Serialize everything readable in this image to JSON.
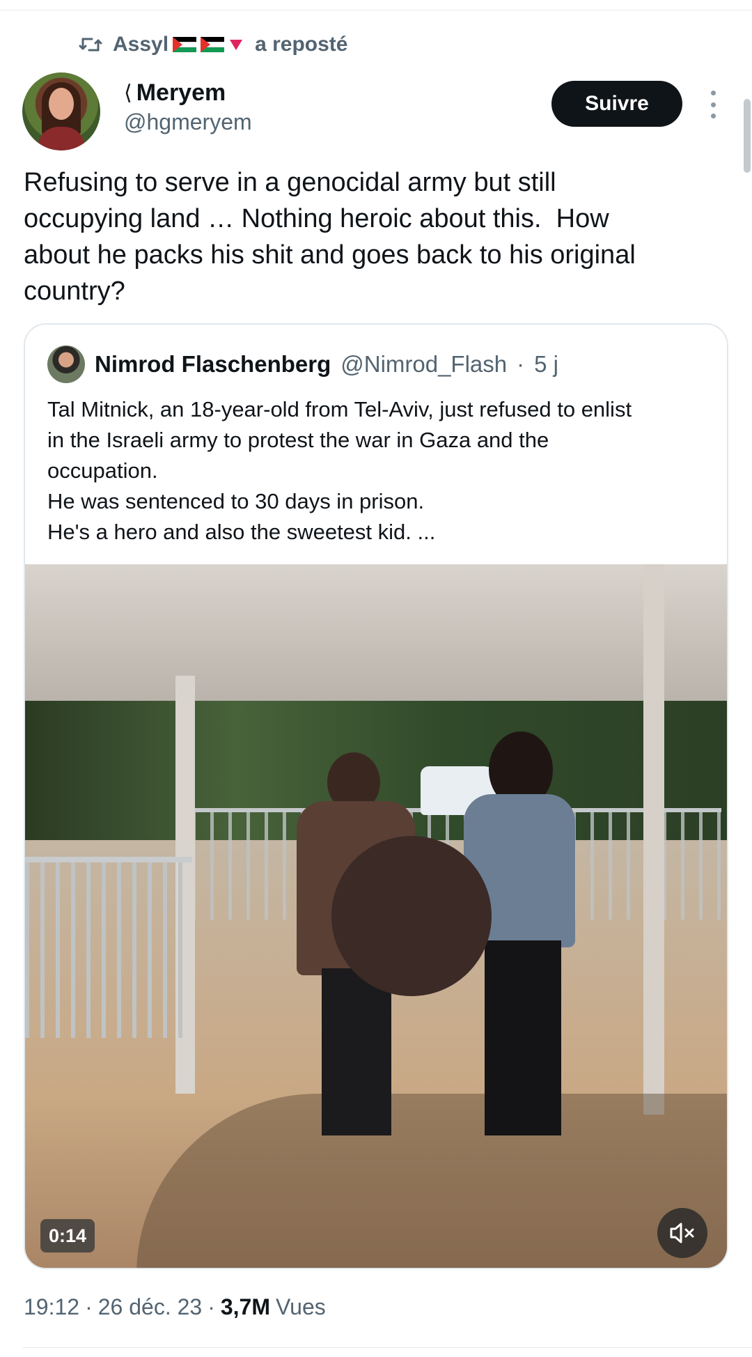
{
  "repost": {
    "icon": "retweet-icon",
    "user_name": "Assyl",
    "flags": [
      "🇪🇭",
      "🇪🇭",
      "🔻"
    ],
    "label": "a reposté"
  },
  "author": {
    "name": "Meryem",
    "name_glyph": "⟨",
    "handle": "@hgmeryem",
    "avatar_icon": "profile-photo"
  },
  "follow_button": {
    "label": "Suivre"
  },
  "more_button": {
    "icon": "more-vertical-icon"
  },
  "tweet": {
    "text": "Refusing to serve in a genocidal army but still\noccupying land … Nothing heroic about this.  How\nabout he packs his shit and goes back to his original\ncountry?"
  },
  "quote": {
    "author_name": "Nimrod Flaschenberg",
    "handle": "@Nimrod_Flash",
    "separator": "·",
    "time": "5 j",
    "lines": [
      "Tal Mitnick, an 18-year-old from Tel-Aviv, just refused to enlist",
      "in the Israeli army to protest the war in Gaza and the",
      "occupation.",
      "He was sentenced to 30 days in prison.",
      "He's a hero and also the sweetest kid. ..."
    ],
    "video": {
      "duration": "0:14",
      "mute_icon": "speaker-muted-icon"
    }
  },
  "meta": {
    "time": "19:12",
    "sep1": "·",
    "date": "26 déc. 23",
    "sep2": "·",
    "views_count": "3,7M",
    "views_label": "Vues"
  },
  "colors": {
    "text_primary": "#0f1419",
    "text_secondary": "#536471",
    "follow_bg": "#0f1419",
    "border": "#e1e8ed"
  }
}
